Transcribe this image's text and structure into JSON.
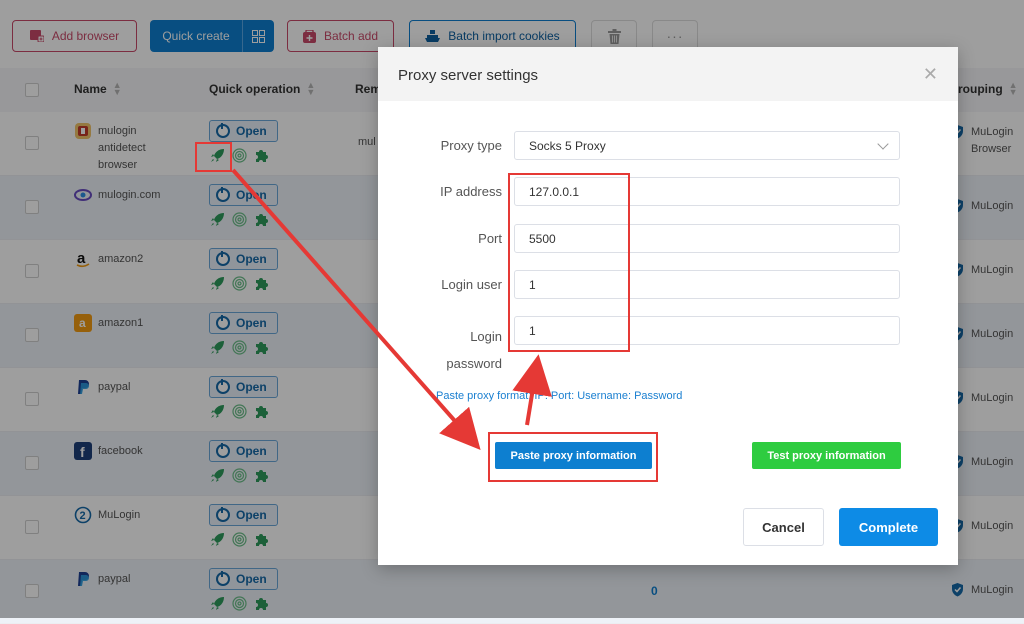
{
  "toolbar": {
    "add_browser": "Add browser",
    "quick_create": "Quick create",
    "batch_add": "Batch add",
    "batch_import_cookies": "Batch import cookies",
    "more": "···"
  },
  "table": {
    "headers": {
      "name": "Name",
      "quick_operation": "Quick operation",
      "remark": "Rem",
      "grouping": "rouping"
    },
    "open_label": "Open",
    "rows": [
      {
        "name": "mulogin antidetect browser",
        "icon": "mulogin-box-icon",
        "remark": "mul",
        "group": "MuLogin Browser"
      },
      {
        "name": "mulogin.com",
        "icon": "mulogin-eye-icon",
        "remark": "",
        "group": "MuLogin"
      },
      {
        "name": "amazon2",
        "icon": "amazon-icon",
        "remark": "",
        "group": "MuLogin"
      },
      {
        "name": "amazon1",
        "icon": "amazon-orange-icon",
        "remark": "",
        "group": "MuLogin"
      },
      {
        "name": "paypal",
        "icon": "paypal-icon",
        "remark": "",
        "group": "MuLogin"
      },
      {
        "name": "facebook",
        "icon": "facebook-icon",
        "remark": "",
        "group": "MuLogin"
      },
      {
        "name": "MuLogin",
        "icon": "mulogin-2-icon",
        "remark": "",
        "group": "MuLogin"
      },
      {
        "name": "paypal",
        "icon": "paypal-icon",
        "remark": "0",
        "group": "MuLogin"
      }
    ]
  },
  "modal": {
    "title": "Proxy server settings",
    "fields": {
      "proxy_type": {
        "label": "Proxy type",
        "value": "Socks 5 Proxy"
      },
      "ip_address": {
        "label": "IP address",
        "value": "127.0.0.1"
      },
      "port": {
        "label": "Port",
        "value": "5500"
      },
      "login_user": {
        "label": "Login user",
        "value": "1"
      },
      "login_password": {
        "label": "Login password",
        "value": "1"
      }
    },
    "hint": "Paste proxy format: IP: Port: Username: Password",
    "paste_button": "Paste proxy information",
    "test_button": "Test proxy information",
    "cancel_button": "Cancel",
    "complete_button": "Complete"
  },
  "colors": {
    "primary": "#0d7fd0",
    "success": "#2ecc40",
    "annotation": "#e53935",
    "accent_pink": "#c94a6a"
  }
}
